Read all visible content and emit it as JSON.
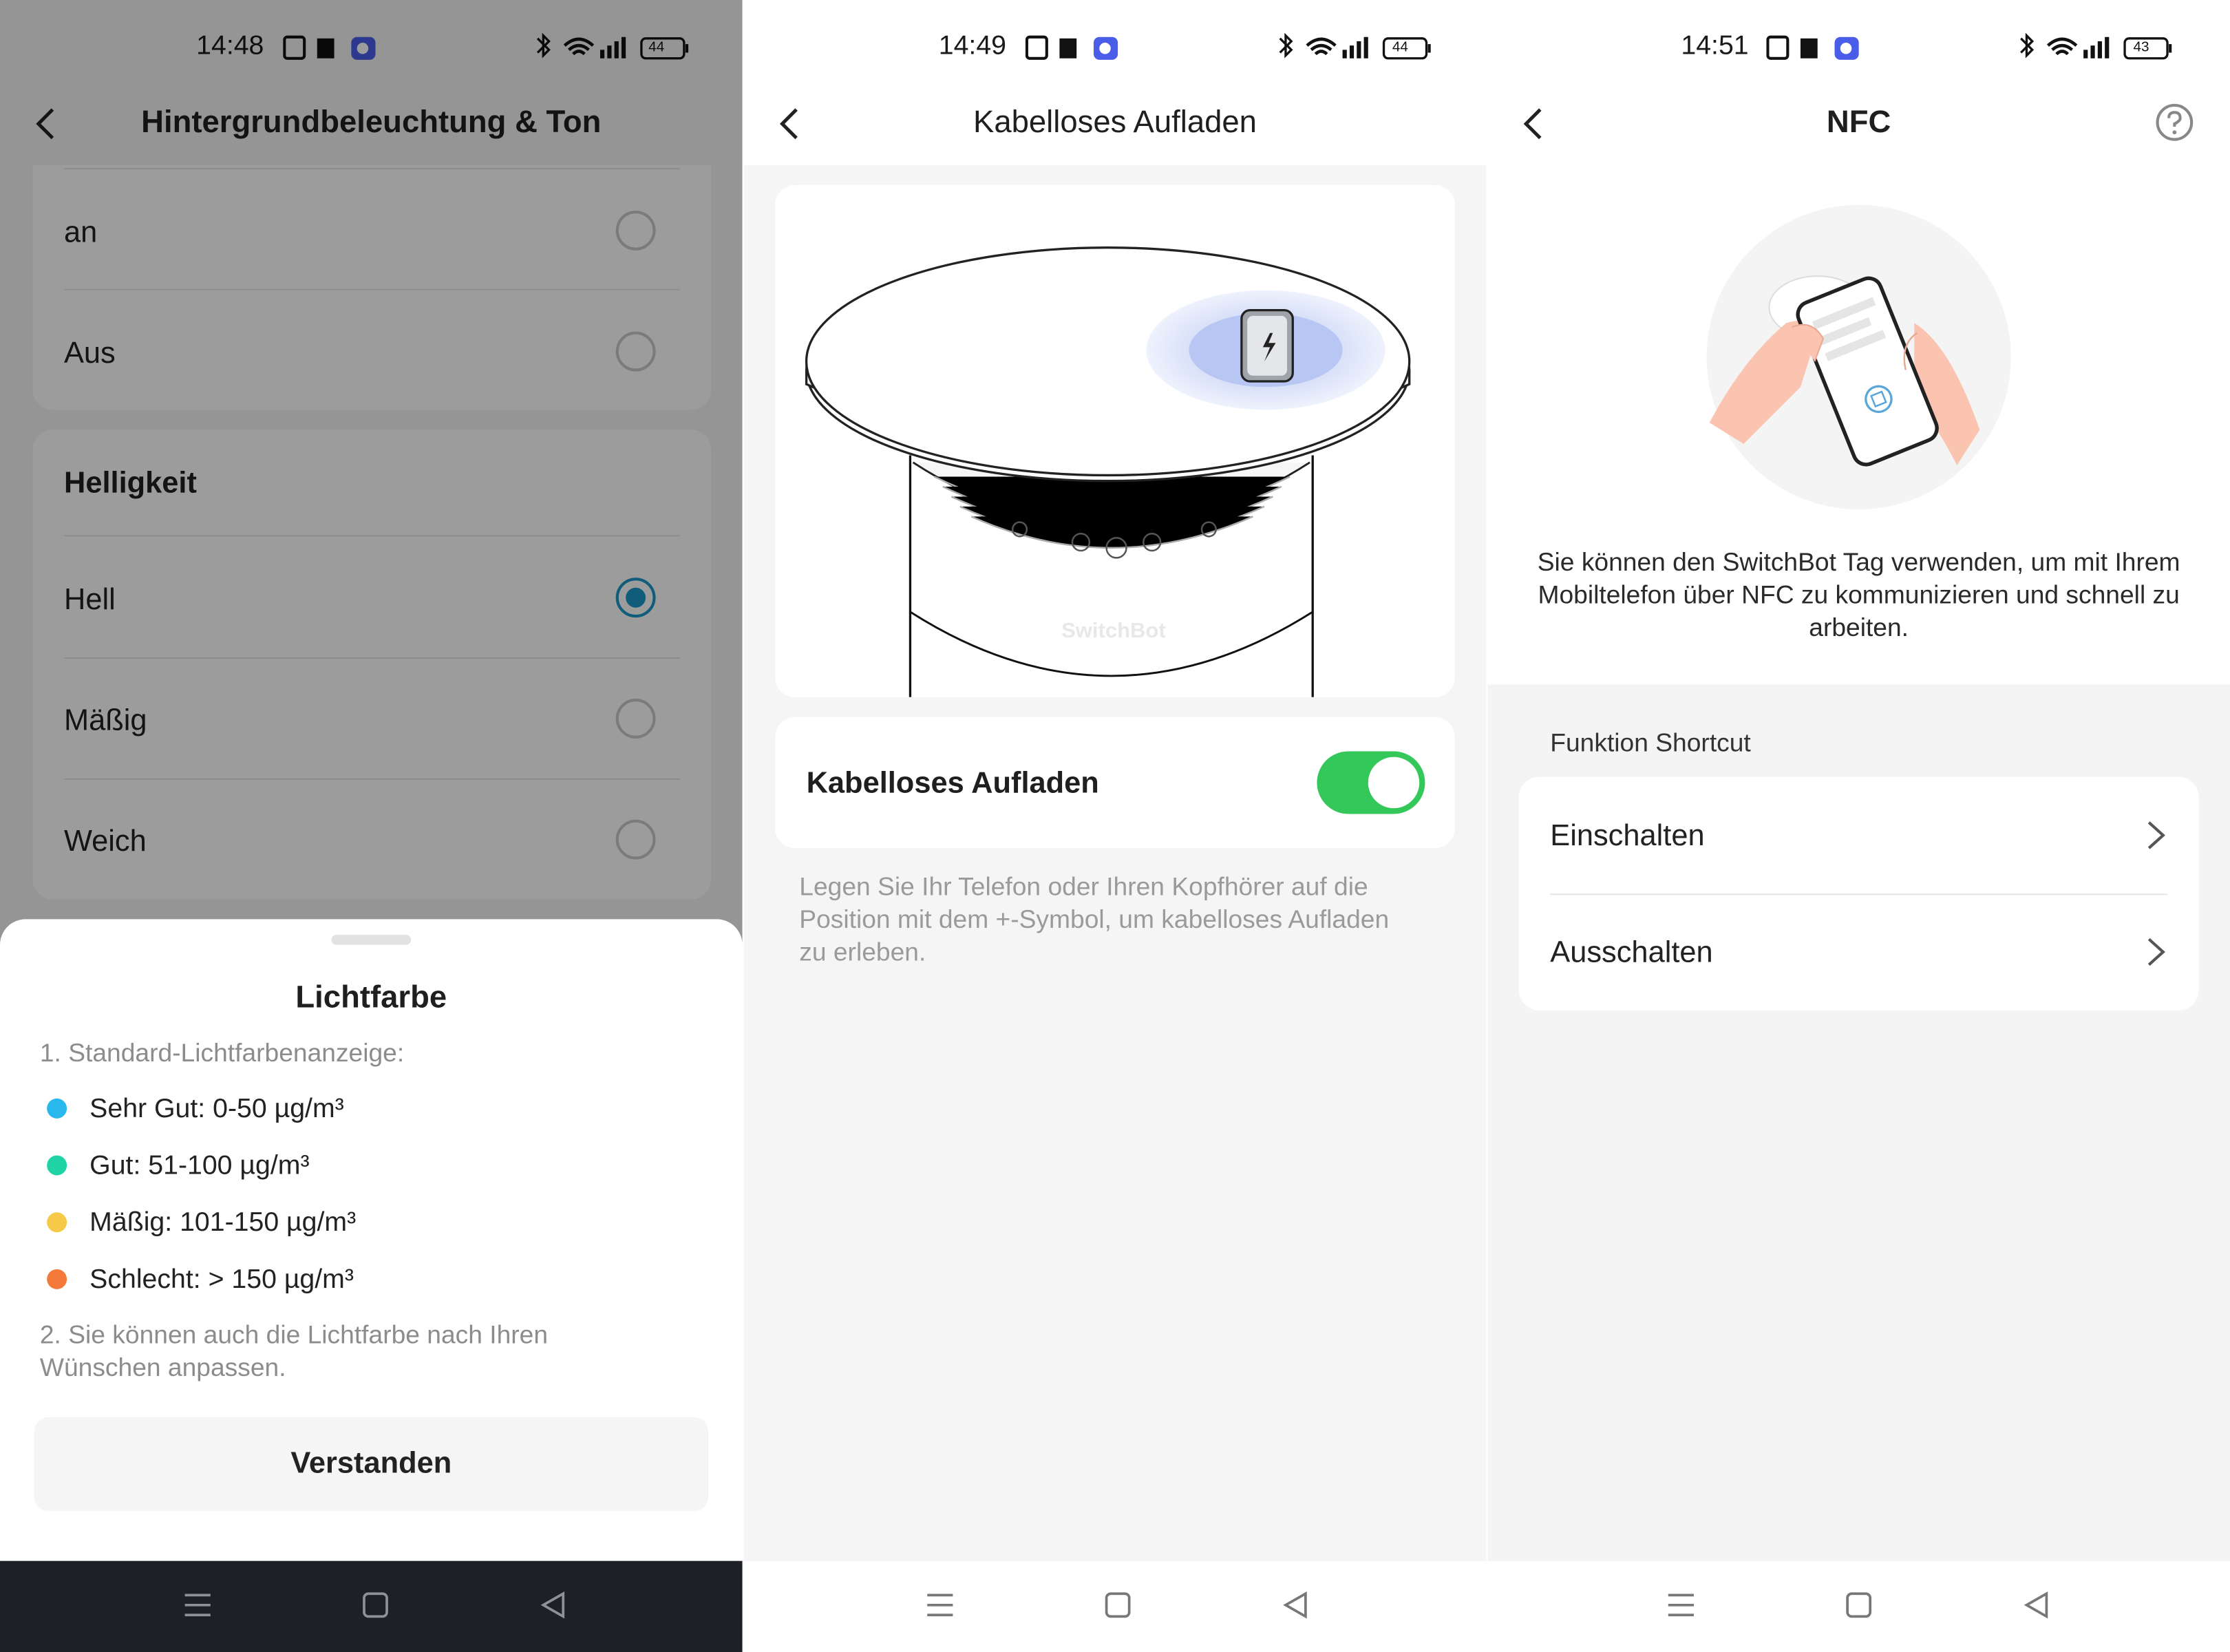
{
  "screens": {
    "brightness": {
      "status": {
        "time": "14:48",
        "battery": "44"
      },
      "header": {
        "title": "Hintergrundbeleuchtung & Ton"
      },
      "mode_options": [
        {
          "label": "an",
          "selected": false
        },
        {
          "label": "Aus",
          "selected": false
        }
      ],
      "brightness": {
        "title": "Helligkeit",
        "options": [
          {
            "label": "Hell",
            "selected": true
          },
          {
            "label": "Mäßig",
            "selected": false
          },
          {
            "label": "Weich",
            "selected": false
          }
        ]
      },
      "sheet": {
        "title": "Lichtfarbe",
        "intro": "1. Standard-Lichtfarbenanzeige:",
        "legend": [
          {
            "label": "Sehr Gut: 0-50 µg/m³",
            "color": "#29b8ee"
          },
          {
            "label": "Gut: 51-100 µg/m³",
            "color": "#1fd3a4"
          },
          {
            "label": "Mäßig: 101-150 µg/m³",
            "color": "#f7c948"
          },
          {
            "label": "Schlecht: > 150 µg/m³",
            "color": "#f47a3a"
          }
        ],
        "note": "2. Sie können auch die Lichtfarbe nach Ihren Wünschen anpassen.",
        "button": "Verstanden"
      }
    },
    "wireless": {
      "status": {
        "time": "14:49",
        "battery": "44"
      },
      "header": {
        "title": "Kabelloses Aufladen"
      },
      "illustration_brand": "SwitchBot",
      "toggle": {
        "label": "Kabelloses Aufladen",
        "on": true,
        "color": "#34c759"
      },
      "hint": "Legen Sie Ihr Telefon oder Ihren Kopfhörer auf die Position mit dem +-Symbol, um kabelloses Aufladen zu erleben."
    },
    "nfc": {
      "status": {
        "time": "14:51",
        "battery": "43"
      },
      "header": {
        "title": "NFC"
      },
      "description": "Sie können den SwitchBot Tag verwenden, um mit Ihrem Mobiltelefon über NFC zu kommunizieren und schnell zu arbeiten.",
      "section_title": "Funktion Shortcut",
      "items": [
        {
          "label": "Einschalten"
        },
        {
          "label": "Ausschalten"
        }
      ]
    }
  },
  "icons": {
    "back": "chevron-left-icon",
    "help": "question-circle-icon",
    "nav": [
      "menu-icon",
      "home-square-icon",
      "back-triangle-icon"
    ]
  },
  "colors": {
    "accent": "#1a97c9",
    "toggle_on": "#34c759"
  }
}
